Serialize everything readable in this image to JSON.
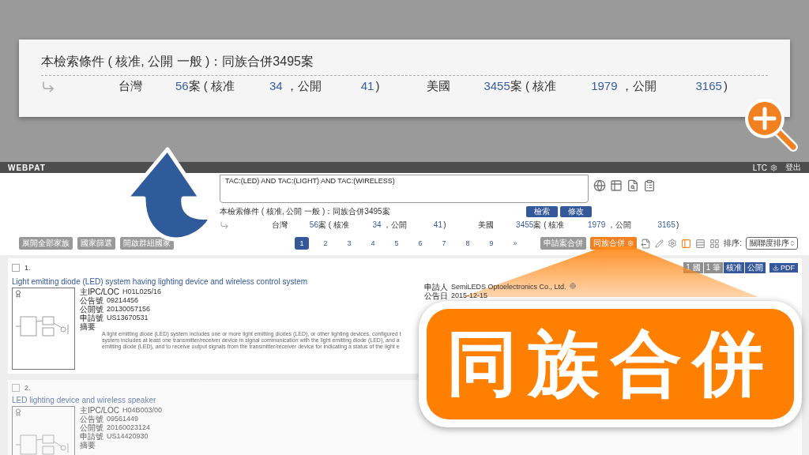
{
  "zoom_panel": {
    "condition": "本檢索條件 ( 核准, 公開 一般 )：同族合併3495案",
    "countries": [
      {
        "name": "台灣",
        "total": "56",
        "unit": "案 ( 核准",
        "approved": "34",
        "sep": "，公開",
        "published": "41",
        "close": ")"
      },
      {
        "name": "美國",
        "total": "3455",
        "unit": "案 ( 核准",
        "approved": "1979",
        "sep": "，公開",
        "published": "3165",
        "close": ")"
      }
    ]
  },
  "header": {
    "logo": "WEBPAT",
    "user": "LTC",
    "logout": "登出"
  },
  "search": {
    "query": "TAC:(LED) AND TAC:(LIGHT) AND TAC:(WIRELESS)",
    "buttons": [
      "檢索",
      "修改"
    ],
    "condition": "本檢索條件 ( 核准, 公開 一般 )：同族合併3495案",
    "countries": [
      {
        "name": "台灣",
        "total": "56",
        "unit": "案 ( 核准",
        "approved": "34",
        "sep": "，公開",
        "published": "41",
        "close": ")"
      },
      {
        "name": "美國",
        "total": "3455",
        "unit": "案 ( 核准",
        "approved": "1979",
        "sep": "，公開",
        "published": "3165",
        "close": ")"
      }
    ]
  },
  "toolbar": {
    "left_buttons": [
      "展開全部家族",
      "國家篩選",
      "開啟群組國家"
    ],
    "pages": [
      {
        "label": "1",
        "selected": true
      },
      {
        "label": "2",
        "selected": false
      },
      {
        "label": "3",
        "selected": false
      },
      {
        "label": "4",
        "selected": false
      },
      {
        "label": "5",
        "selected": false
      },
      {
        "label": "6",
        "selected": false
      },
      {
        "label": "7",
        "selected": false
      },
      {
        "label": "8",
        "selected": false
      },
      {
        "label": "9",
        "selected": false
      },
      {
        "label": "»",
        "selected": false
      }
    ],
    "merge_buttons": [
      {
        "label": "申請案合併",
        "selected": false
      },
      {
        "label": "同族合併",
        "selected": true
      }
    ],
    "views": [
      {
        "selected": true
      },
      {
        "selected": false
      },
      {
        "selected": false
      }
    ],
    "sort_label": "排序:",
    "sort_value": "關聯度排序"
  },
  "results": [
    {
      "index": "1.",
      "checked": false,
      "dimmed": false,
      "title": "Light emitting diode (LED) system having lighting device and wireless control system",
      "tags": [
        {
          "label": "1 國",
          "kind": "count"
        },
        {
          "label": "1 筆",
          "kind": "count"
        },
        {
          "label": "核准",
          "kind": "status"
        },
        {
          "label": "公開",
          "kind": "status"
        }
      ],
      "pdf": "PDF",
      "fields": [
        {
          "label": "主IPC/LOC",
          "value": "H01L025/16"
        },
        {
          "label": "公告號",
          "value": "09214456"
        },
        {
          "label": "公開號",
          "value": "20130057156"
        },
        {
          "label": "申請號",
          "value": "US13670531"
        }
      ],
      "abstract_label": "摘要",
      "abstract_lines": [
        "A light emitting diode (LED) system includes one or more light emitting diodes (LED), or other lighting devices, configured t",
        "system includes at least one transmitter/receiver device in signal communication with the light emitting diode (LED), and a",
        "emitting diode (LED), and to receive output signals from the transmitter/receiver device for indicating a status of the light e"
      ],
      "right_fields": [
        {
          "label": "申請人",
          "value": "SemiLEDS Optoelectronics Co., Ltd."
        },
        {
          "label": "公告日",
          "value": "2015-12-15"
        }
      ]
    },
    {
      "index": "2.",
      "checked": false,
      "dimmed": true,
      "title": "LED lighting device and wireless speaker",
      "fields": [
        {
          "label": "主IPC/LOC",
          "value": "H04B003/00"
        },
        {
          "label": "公告號",
          "value": "09561449"
        },
        {
          "label": "公開號",
          "value": "20160023124"
        },
        {
          "label": "申請號",
          "value": "US14420930"
        }
      ],
      "abstract_label": "摘要"
    }
  ],
  "callout": {
    "label": "同族合併"
  }
}
